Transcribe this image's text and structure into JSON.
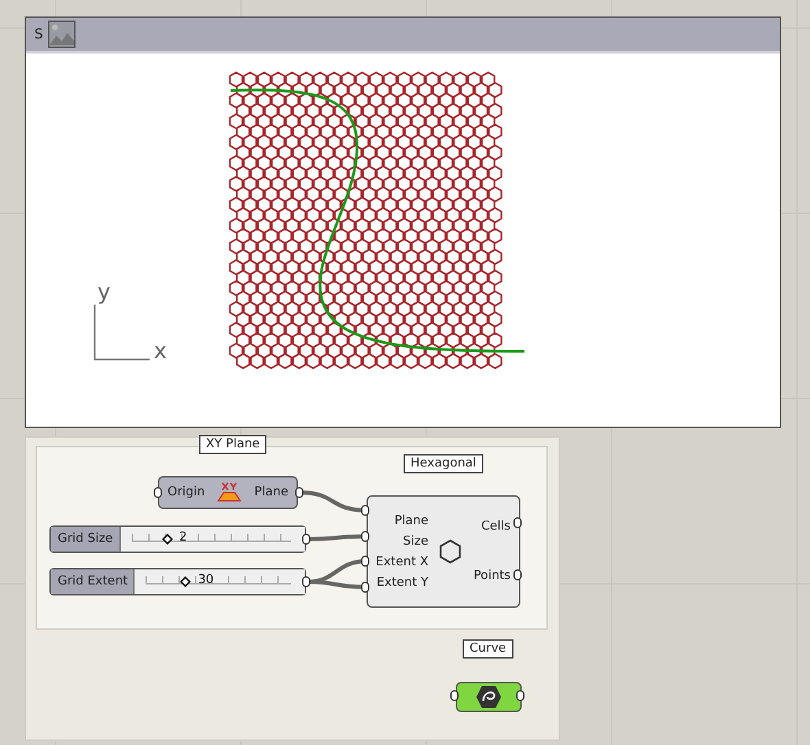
{
  "viewer": {
    "title": "S",
    "axis_labels": [
      "y",
      "x"
    ]
  },
  "plane_node": {
    "tag": "XY Plane",
    "input": "Origin",
    "output": "Plane"
  },
  "sliders": [
    {
      "name": "Grid Size",
      "value": "2",
      "level": 0.25
    },
    {
      "name": "Grid Extent",
      "value": "30",
      "level": 0.3
    }
  ],
  "hex_node": {
    "tag": "Hexagonal",
    "inputs": [
      "Plane",
      "Size",
      "Extent X",
      "Extent Y"
    ],
    "outputs": [
      "Cells",
      "Points"
    ]
  },
  "curve_node": {
    "tag": "Curve"
  }
}
